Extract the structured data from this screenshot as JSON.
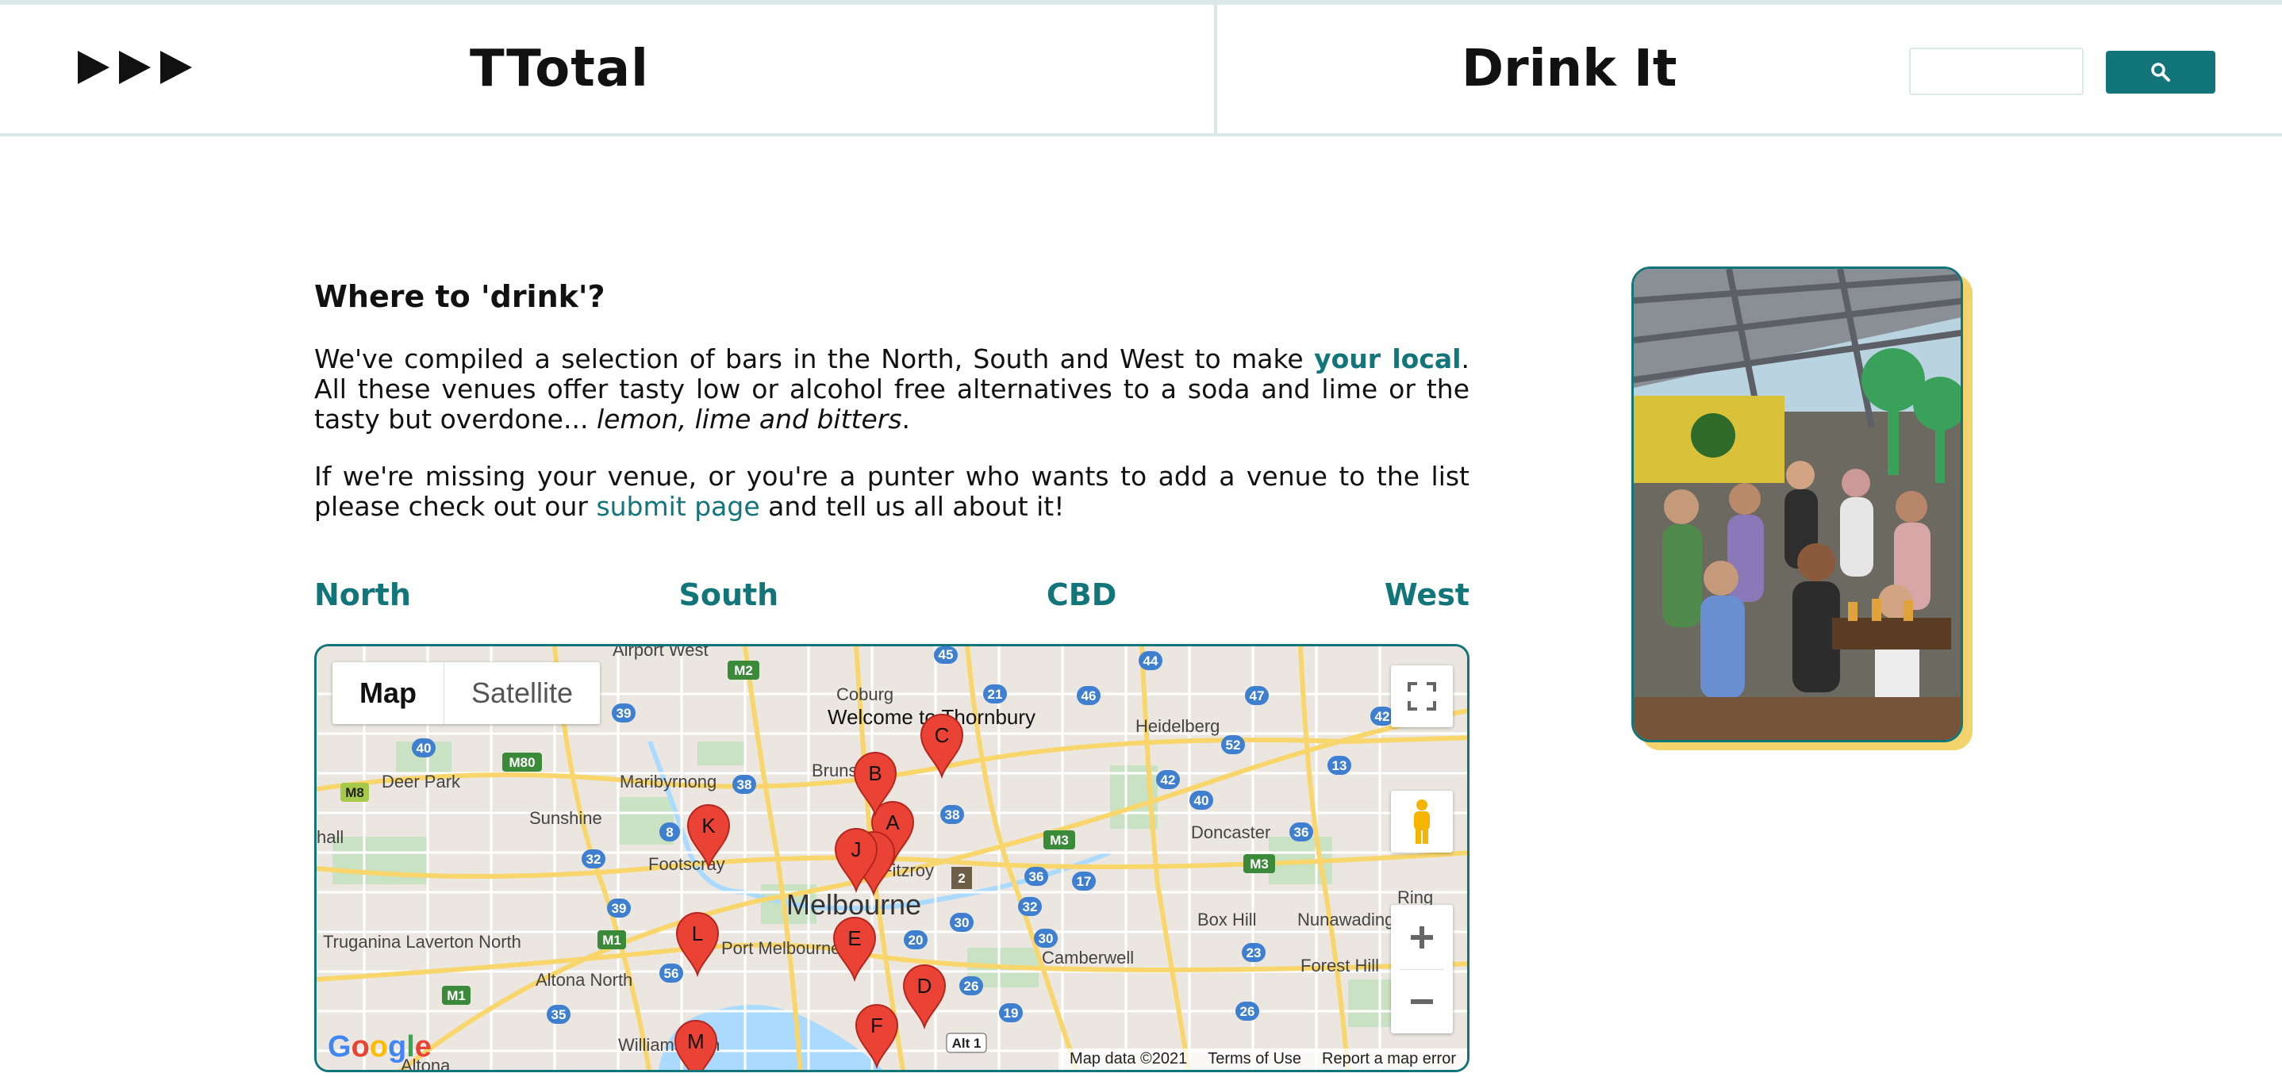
{
  "header": {
    "brand": "TTotal",
    "section_title": "Drink It",
    "search": {
      "value": "",
      "placeholder": ""
    }
  },
  "main": {
    "title": "Where to 'drink'?",
    "p1": {
      "t1": "We've compiled a selection of bars in the North, South and West to make ",
      "link": "your local",
      "t2": ". All these venues offer tasty low or alcohol free alternatives to a soda and lime or the tasty but overdone... ",
      "italic": "lemon, lime and bitters",
      "t3": "."
    },
    "p2": {
      "t1": "If we're missing your venue, or you're a punter who wants to add a venue to the list please check out our ",
      "link": "submit page",
      "t2": " and tell us all about it!"
    },
    "regions": [
      "North",
      "South",
      "CBD",
      "West"
    ]
  },
  "map": {
    "type_options": [
      "Map",
      "Satellite"
    ],
    "active_type": "Map",
    "google_logo": "Google",
    "attribution": [
      "Map data ©2021",
      "Terms of Use",
      "Report a map error"
    ],
    "places": {
      "airport_west": "Airport West",
      "coburg": "Coburg",
      "welcome": "Welcome to Thornbury",
      "heidelberg": "Heidelberg",
      "deer_park": "Deer Park",
      "maribyrnong": "Maribyrnong",
      "brunswick": "Brunswick",
      "sunshine": "Sunshine",
      "doncaster": "Doncaster",
      "footscray": "Footscray",
      "fitzroy": "Fitzroy",
      "melbourne": "Melbourne",
      "box_hill": "Box Hill",
      "nunawading": "Nunawading",
      "truganina": "Truganina Laverton North",
      "port_melbourne": "Port Melbourne",
      "camberwell": "Camberwell",
      "forest_hill": "Forest Hill",
      "altona_north": "Altona North",
      "williamstown": "Williamstown",
      "altona": "Altona",
      "ring": "Ring",
      "hall": "hall"
    },
    "markers": [
      "A",
      "B",
      "C",
      "D",
      "E",
      "F",
      "I",
      "J",
      "K",
      "L",
      "M"
    ],
    "route_shields": [
      "M2",
      "45",
      "21",
      "46",
      "44",
      "39",
      "47",
      "42",
      "40",
      "M80",
      "52",
      "13",
      "M8",
      "38",
      "42",
      "40",
      "8",
      "38",
      "36",
      "32",
      "M3",
      "M3",
      "36",
      "17",
      "2",
      "39",
      "30",
      "32",
      "M1",
      "20",
      "23",
      "56",
      "30",
      "M1",
      "35",
      "26",
      "19",
      "Alt 1",
      "26"
    ]
  },
  "colors": {
    "accent": "#12757a",
    "photo_shadow": "#f3d36b",
    "marker": "#ea4335"
  }
}
